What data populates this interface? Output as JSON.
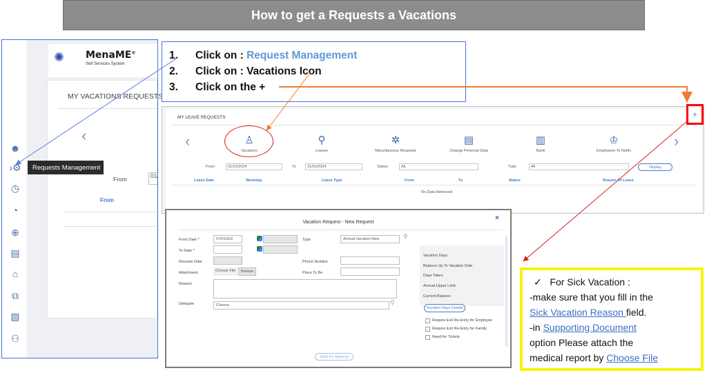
{
  "title": "How to get a Requests  a Vacations",
  "app": {
    "logo_name": "MenaME",
    "logo_sub": "Self Services System",
    "page_title": "MY VACATIONS REQUESTS",
    "tooltip": "Requests Management",
    "from_label": "From",
    "from_value": "01/",
    "col_from": "From",
    "sidebar_icons": [
      "users-icon",
      "requests-icon",
      "clock-icon",
      "gauge-icon",
      "search-icon",
      "building-icon",
      "bank-icon",
      "transfer-icon",
      "stripes-icon",
      "people-icon"
    ]
  },
  "instructions": {
    "steps": [
      {
        "num": "1.",
        "text": "Click on : ",
        "link": "Request Management"
      },
      {
        "num": "2.",
        "text": "Click on : Vacations Icon"
      },
      {
        "num": "3.",
        "text": "Click on the +"
      }
    ]
  },
  "leave_panel": {
    "title": "MY LEAVE REQUESTS",
    "plus": "+",
    "categories": [
      {
        "label": "Vacations",
        "icon": "♙"
      },
      {
        "label": "Leaves",
        "icon": "⚲"
      },
      {
        "label": "Miscellaneous Requests",
        "icon": "✲"
      },
      {
        "label": "Change Personal Data",
        "icon": "▤"
      },
      {
        "label": "Bank",
        "icon": "▥"
      },
      {
        "label": "Employees To Notify",
        "icon": "♔"
      }
    ],
    "filters": {
      "from_label": "From",
      "from_value": "01/01/2024",
      "to_label": "To",
      "to_value": "31/01/2024",
      "status_label": "Status",
      "status_value": "All",
      "type_label": "Type",
      "type_value": "All",
      "display_button": "Display"
    },
    "columns": [
      "Leave Date",
      "Weekday",
      "Leave Type",
      "From",
      "To",
      "Status",
      "Reason Of Leave"
    ],
    "no_data": "No Data Retrieved"
  },
  "dialog": {
    "title": "Vacation Request - New Request",
    "close": "×",
    "from_date_label": "From Date *",
    "from_date_value": "07/01/202",
    "to_date_label": "To Date *",
    "resume_date_label": "Resume Date",
    "attachment_label": "Attachment",
    "choose_file": "Choose File",
    "browse": "Browse",
    "reason_label": "Reason",
    "delegate_label": "Delegate",
    "delegate_value": "Choose",
    "type_label": "Type",
    "type_value": "Annual Vacation New",
    "phone_label": "Phone Number",
    "place_label": "Place To Be",
    "side_items": [
      "Vacation Days",
      "Balance Up To Vacation Date",
      "Days Taken",
      "Annual Upper Limit",
      "Current Balance"
    ],
    "vacation_days_details": "Vacation Days Details",
    "checkboxes": [
      "Require Exit Re-Entry for Employee",
      "Require Exit Re-Entry for Family",
      "Need for Tickets"
    ],
    "send_button": "Send For Approval"
  },
  "note": {
    "check": "✓",
    "heading": "For Sick Vacation :",
    "line1": "-make sure that you fill in the",
    "link1": "Sick Vacation Reason ",
    "after_link1": "field.",
    "line3_pre": "-in ",
    "link2": "Supporting Document",
    "line4": "option Please attach the",
    "line5_pre": "medical report by ",
    "link3": "Choose File"
  },
  "colors": {
    "banner": "#8c8c8c",
    "frame_blue": "#4a6fd8",
    "red": "#ff0000",
    "orange": "#ed7d31",
    "note_border": "#f5f500"
  }
}
